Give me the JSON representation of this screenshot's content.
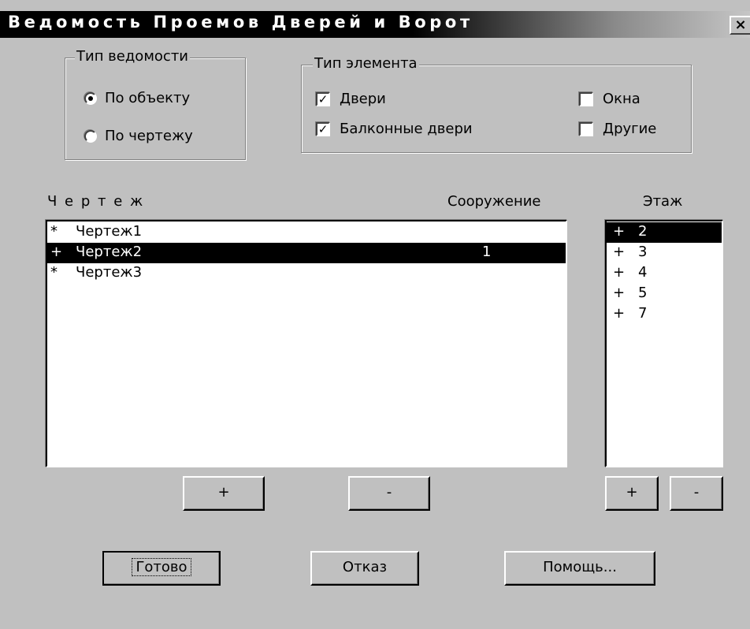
{
  "window": {
    "title": "Ведомость Проемов Дверей и Ворот",
    "close_label": "×"
  },
  "report_type": {
    "label": "Тип ведомости",
    "options": [
      {
        "label": "По объекту",
        "selected": true
      },
      {
        "label": "По чертежу",
        "selected": false
      }
    ]
  },
  "element_type": {
    "label": "Тип элемента",
    "items": [
      {
        "label": "Двери",
        "checked": true,
        "mark": "✓"
      },
      {
        "label": "Окна",
        "checked": false,
        "mark": ""
      },
      {
        "label": "Балконные двери",
        "checked": true,
        "mark": "✓"
      },
      {
        "label": "Другие",
        "checked": false,
        "mark": ""
      }
    ]
  },
  "drawings": {
    "header_drawing": "Ч е р т е ж",
    "header_building": "Сооружение",
    "rows": [
      {
        "mark": "*",
        "name": "Чертеж1",
        "building": "",
        "selected": false
      },
      {
        "mark": "+",
        "name": "Чертеж2",
        "building": "1",
        "selected": true
      },
      {
        "mark": "*",
        "name": "Чертеж3",
        "building": "",
        "selected": false
      }
    ],
    "add_label": "+",
    "remove_label": "-"
  },
  "floors": {
    "header": "Этаж",
    "rows": [
      {
        "mark": "+",
        "floor": "2",
        "selected": true
      },
      {
        "mark": "+",
        "floor": "3",
        "selected": false
      },
      {
        "mark": "+",
        "floor": "4",
        "selected": false
      },
      {
        "mark": "+",
        "floor": "5",
        "selected": false
      },
      {
        "mark": "+",
        "floor": "7",
        "selected": false
      }
    ],
    "add_label": "+",
    "remove_label": "-"
  },
  "actions": {
    "ok_label": "Готово",
    "cancel_label": "Отказ",
    "help_label": "Помощь..."
  }
}
